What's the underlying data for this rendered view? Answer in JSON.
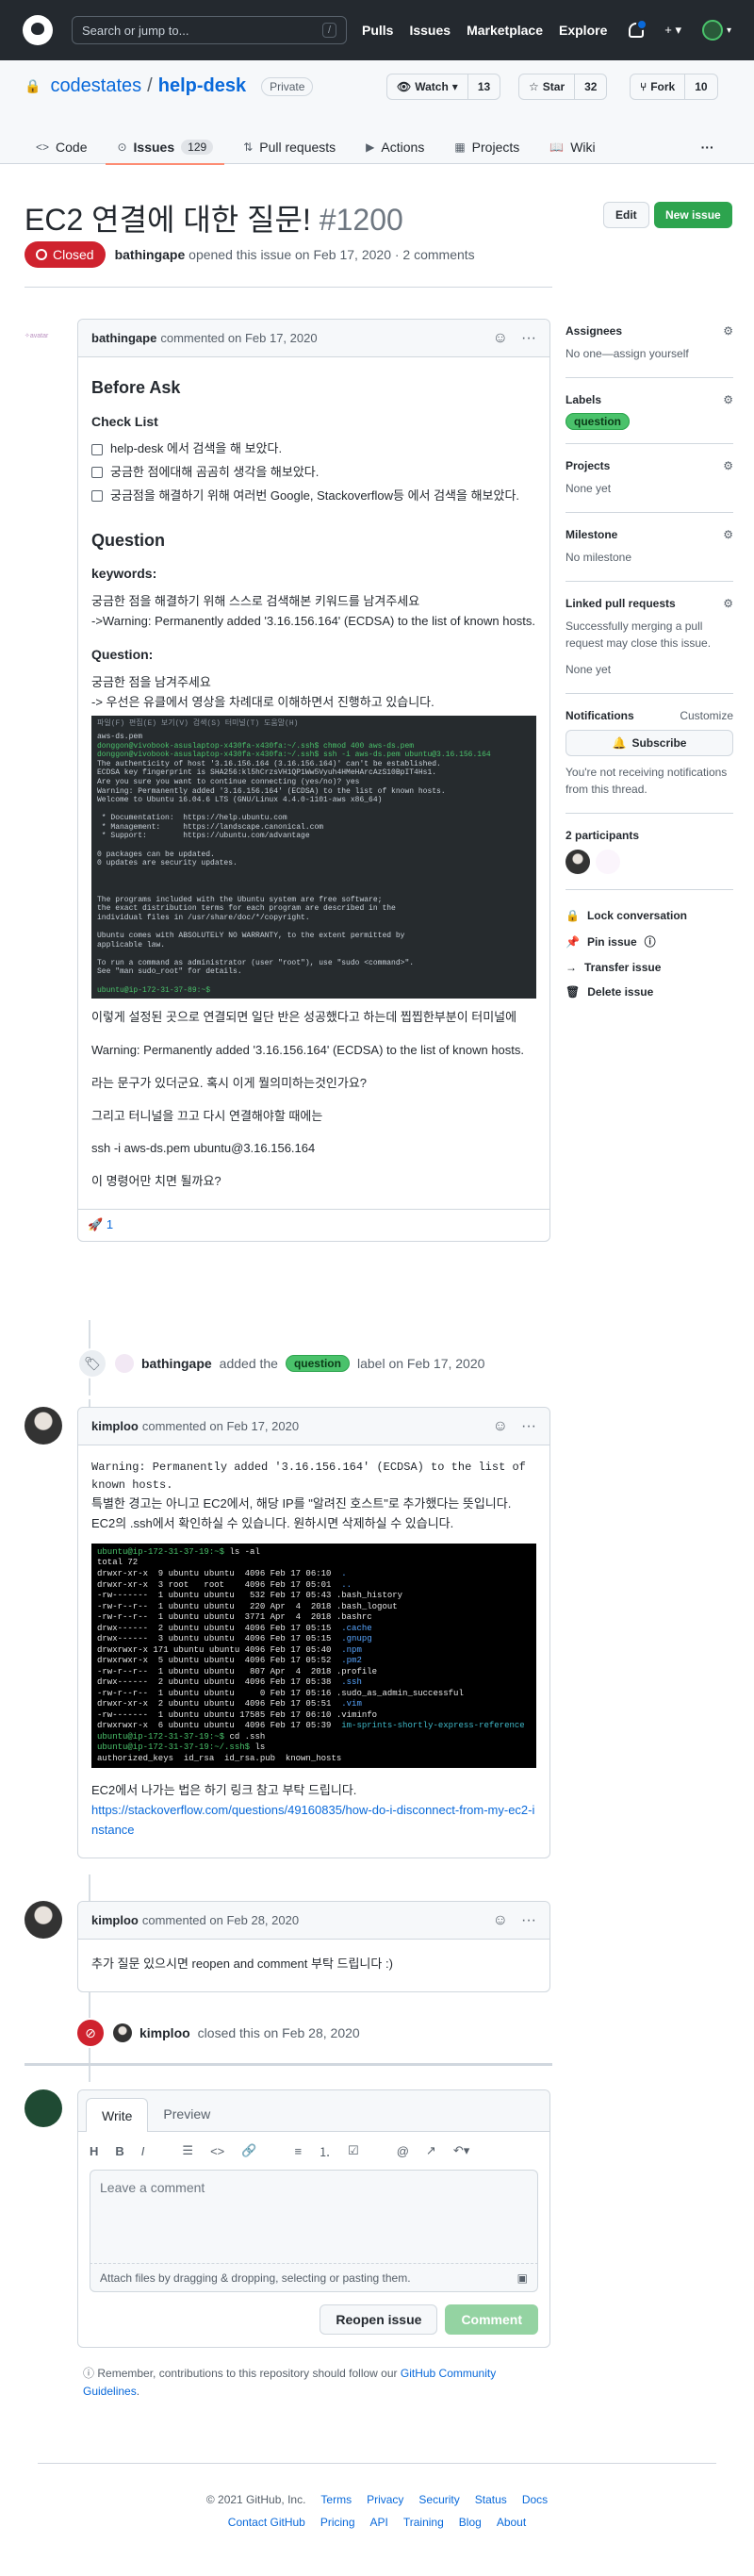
{
  "header": {
    "search_placeholder": "Search or jump to...",
    "search_key": "/",
    "nav": [
      "Pulls",
      "Issues",
      "Marketplace",
      "Explore"
    ]
  },
  "repo": {
    "owner": "codestates",
    "sep": "/",
    "name": "help-desk",
    "visibility": "Private",
    "watch_label": "Watch",
    "watch_count": "13",
    "star_label": "Star",
    "star_count": "32",
    "fork_label": "Fork",
    "fork_count": "10",
    "tabs": [
      {
        "icon": "code-icon",
        "label": "Code"
      },
      {
        "icon": "issue-icon",
        "label": "Issues",
        "count": "129"
      },
      {
        "icon": "pull-request-icon",
        "label": "Pull requests"
      },
      {
        "icon": "actions-icon",
        "label": "Actions"
      },
      {
        "icon": "projects-icon",
        "label": "Projects"
      },
      {
        "icon": "wiki-icon",
        "label": "Wiki"
      }
    ],
    "more": "···"
  },
  "issue": {
    "title": "EC2 연결에 대한 질문!",
    "number": "#1200",
    "edit": "Edit",
    "new_issue": "New issue",
    "state": "Closed",
    "author": "bathingape",
    "meta": "opened this issue on Feb 17, 2020 · 2 comments"
  },
  "comment1": {
    "author": "bathingape",
    "when": "commented on Feb 17, 2020",
    "before_ask": "Before Ask",
    "checklist_title": "Check List",
    "checklist": [
      "help-desk 에서 검색을 해 보았다.",
      "궁금한 점에대해 곰곰히 생각을 해보았다.",
      "궁금점을 해결하기 위해 여러번 Google, Stackoverflow등 에서 검색을 해보았다."
    ],
    "question_h": "Question",
    "keywords_h": "keywords:",
    "keywords_1": "궁금한 점을 해결하기 위해 스스로 검색해본 키워드를 남겨주세요",
    "keywords_2": "->Warning: Permanently added '3.16.156.164' (ECDSA) to the list of known hosts.",
    "question2_h": "Question:",
    "q_1": "궁금한 점을 남겨주세요",
    "q_2": "-> 우선은 유클에서 영상을 차례대로 이해하면서 진행하고 있습니다.",
    "terminal": {
      "menu": "파일(F)  편집(E)  보기(V)  검색(S)  터미널(T)  도움말(H)",
      "lines": [
        [
          "",
          "aws-ds.pem"
        ],
        [
          "g",
          "donggon@vivobook-asuslaptop-x430fa-x430fa:~/.ssh$ chmod 400 aws-ds.pem"
        ],
        [
          "g",
          "donggon@vivobook-asuslaptop-x430fa-x430fa:~/.ssh$ ssh -i aws-ds.pem ubuntu@3.16.156.164"
        ],
        [
          "",
          "The authenticity of host '3.16.156.164 (3.16.156.164)' can't be established."
        ],
        [
          "",
          "ECDSA key fingerprint is SHA256:kl5hCrzsVH1QP1Ww5Vyuh4HMeHArcAzS10BpIT4Hs1."
        ],
        [
          "",
          "Are you sure you want to continue connecting (yes/no)? yes"
        ],
        [
          "",
          "Warning: Permanently added '3.16.156.164' (ECDSA) to the list of known hosts."
        ],
        [
          "",
          "Welcome to Ubuntu 16.04.6 LTS (GNU/Linux 4.4.0-1101-aws x86_64)"
        ],
        [
          "",
          " "
        ],
        [
          "",
          " * Documentation:  https://help.ubuntu.com"
        ],
        [
          "",
          " * Management:     https://landscape.canonical.com"
        ],
        [
          "",
          " * Support:        https://ubuntu.com/advantage"
        ],
        [
          "",
          " "
        ],
        [
          "",
          "0 packages can be updated."
        ],
        [
          "",
          "0 updates are security updates."
        ],
        [
          "",
          " "
        ],
        [
          "",
          " "
        ],
        [
          "",
          " "
        ],
        [
          "",
          "The programs included with the Ubuntu system are free software;"
        ],
        [
          "",
          "the exact distribution terms for each program are described in the"
        ],
        [
          "",
          "individual files in /usr/share/doc/*/copyright."
        ],
        [
          "",
          " "
        ],
        [
          "",
          "Ubuntu comes with ABSOLUTELY NO WARRANTY, to the extent permitted by"
        ],
        [
          "",
          "applicable law."
        ],
        [
          "",
          " "
        ],
        [
          "",
          "To run a command as administrator (user \"root\"), use \"sudo <command>\"."
        ],
        [
          "",
          "See \"man sudo_root\" for details."
        ],
        [
          "",
          " "
        ],
        [
          "g",
          "ubuntu@ip-172-31-37-89:~$ "
        ]
      ]
    },
    "p1": "이렇게 설정된 곳으로 연결되면 일단 반은 성공했다고 하는데 찝찝한부분이 터미널에",
    "p2": "Warning: Permanently added '3.16.156.164' (ECDSA) to the list of known hosts.",
    "p3": "라는 문구가 있더군요. 혹시 이게 뭘의미하는것인가요?",
    "p4": "그리고 터니널을 끄고 다시 연결해야할 때에는",
    "p5": "ssh -i aws-ds.pem ubuntu@3.16.156.164",
    "p6": "이 명령어만 치면 될까요?",
    "reaction_emoji": "🚀",
    "reaction_count": "1"
  },
  "label_event": {
    "actor": "bathingape",
    "text_before": "added the",
    "label": "question",
    "text_after": "label on Feb 17, 2020"
  },
  "comment2": {
    "author": "kimploo",
    "when": "commented on Feb 17, 2020",
    "code": "Warning: Permanently added '3.16.156.164' (ECDSA) to the list of known hosts.",
    "line1": "특별한 경고는 아니고 EC2에서, 해당 IP를 \"알려진 호스트\"로 추가했다는 뜻입니다.",
    "line2": "EC2의 .ssh에서 확인하실 수 있습니다. 원하시면 삭제하실 수 있습니다.",
    "terminal": [
      [
        [
          "g",
          "ubuntu@ip-172-31-37-19:~$"
        ],
        [
          "",
          "ls -al"
        ]
      ],
      [
        [
          "",
          "total 72"
        ]
      ],
      [
        [
          "",
          "drwxr-xr-x  9 ubuntu ubuntu  4096 Feb 17 06:10 "
        ],
        [
          "b",
          "."
        ]
      ],
      [
        [
          "",
          "drwxr-xr-x  3 root   root    4096 Feb 17 05:01 "
        ],
        [
          "b",
          ".."
        ]
      ],
      [
        [
          "",
          "-rw-------  1 ubuntu ubuntu   532 Feb 17 05:43 .bash_history"
        ]
      ],
      [
        [
          "",
          "-rw-r--r--  1 ubuntu ubuntu   220 Apr  4  2018 .bash_logout"
        ]
      ],
      [
        [
          "",
          "-rw-r--r--  1 ubuntu ubuntu  3771 Apr  4  2018 .bashrc"
        ]
      ],
      [
        [
          "",
          "drwx------  2 ubuntu ubuntu  4096 Feb 17 05:15 "
        ],
        [
          "b",
          ".cache"
        ]
      ],
      [
        [
          "",
          "drwx------  3 ubuntu ubuntu  4096 Feb 17 05:15 "
        ],
        [
          "b",
          ".gnupg"
        ]
      ],
      [
        [
          "",
          "drwxrwxr-x 171 ubuntu ubuntu 4096 Feb 17 05:40 "
        ],
        [
          "b",
          ".npm"
        ]
      ],
      [
        [
          "",
          "drwxrwxr-x  5 ubuntu ubuntu  4096 Feb 17 05:52 "
        ],
        [
          "b",
          ".pm2"
        ]
      ],
      [
        [
          "",
          "-rw-r--r--  1 ubuntu ubuntu   807 Apr  4  2018 .profile"
        ]
      ],
      [
        [
          "",
          "drwx------  2 ubuntu ubuntu  4096 Feb 17 05:38 "
        ],
        [
          "b",
          ".ssh"
        ]
      ],
      [
        [
          "",
          "-rw-r--r--  1 ubuntu ubuntu     0 Feb 17 05:16 .sudo_as_admin_successful"
        ]
      ],
      [
        [
          "",
          "drwxr-xr-x  2 ubuntu ubuntu  4096 Feb 17 05:51 "
        ],
        [
          "b",
          ".vim"
        ]
      ],
      [
        [
          "",
          "-rw-------  1 ubuntu ubuntu 17585 Feb 17 06:10 .viminfo"
        ]
      ],
      [
        [
          "",
          "drwxrwxr-x  6 ubuntu ubuntu  4096 Feb 17 05:39 "
        ],
        [
          "c",
          "im-sprints-shortly-express-reference"
        ]
      ],
      [
        [
          "g",
          "ubuntu@ip-172-31-37-19:~$"
        ],
        [
          "",
          "cd .ssh"
        ]
      ],
      [
        [
          "g",
          "ubuntu@ip-172-31-37-19:~/.ssh$"
        ],
        [
          "",
          "ls"
        ]
      ],
      [
        [
          "",
          "authorized_keys  id_rsa  id_rsa.pub  known_hosts"
        ]
      ]
    ],
    "line3": "EC2에서 나가는 법은 하기 링크 참고 부탁 드립니다.",
    "link": "https://stackoverflow.com/questions/49160835/how-do-i-disconnect-from-my-ec2-instance"
  },
  "comment3": {
    "author": "kimploo",
    "when": "commented on Feb 28, 2020",
    "text": "추가 질문 있으시면 reopen and comment 부탁 드립니다 :)"
  },
  "close_event": {
    "actor": "kimploo",
    "text": "closed this on Feb 28, 2020"
  },
  "composer": {
    "tab_write": "Write",
    "tab_preview": "Preview",
    "placeholder": "Leave a comment",
    "attach": "Attach files by dragging & dropping, selecting or pasting them.",
    "reopen": "Reopen issue",
    "comment": "Comment",
    "tools": [
      "H",
      "B",
      "I"
    ]
  },
  "remember": {
    "text": "Remember, contributions to this repository should follow our",
    "link": "GitHub Community Guidelines",
    "end": "."
  },
  "sidebar": {
    "assignees_h": "Assignees",
    "assignees_v": "No one—assign yourself",
    "labels_h": "Labels",
    "label": "question",
    "projects_h": "Projects",
    "projects_v": "None yet",
    "milestone_h": "Milestone",
    "milestone_v": "No milestone",
    "linked_h": "Linked pull requests",
    "linked_v": "Successfully merging a pull request may close this issue.",
    "linked_v2": "None yet",
    "notif_h": "Notifications",
    "notif_customize": "Customize",
    "subscribe": "Subscribe",
    "notif_v": "You're not receiving notifications from this thread.",
    "participants_h": "2 participants",
    "lock": "Lock conversation",
    "pin": "Pin issue",
    "transfer": "Transfer issue",
    "delete": "Delete issue"
  },
  "footer": {
    "copyright": "© 2021 GitHub, Inc.",
    "row1": [
      "Terms",
      "Privacy",
      "Security",
      "Status",
      "Docs"
    ],
    "row2": [
      "Contact GitHub",
      "Pricing",
      "API",
      "Training",
      "Blog",
      "About"
    ]
  },
  "colors": {
    "header_bg": "#24292f",
    "closed_red": "#cf222e",
    "accent_blue": "#0969da",
    "green": "#2da44e",
    "label_question": "#4ac26b"
  }
}
